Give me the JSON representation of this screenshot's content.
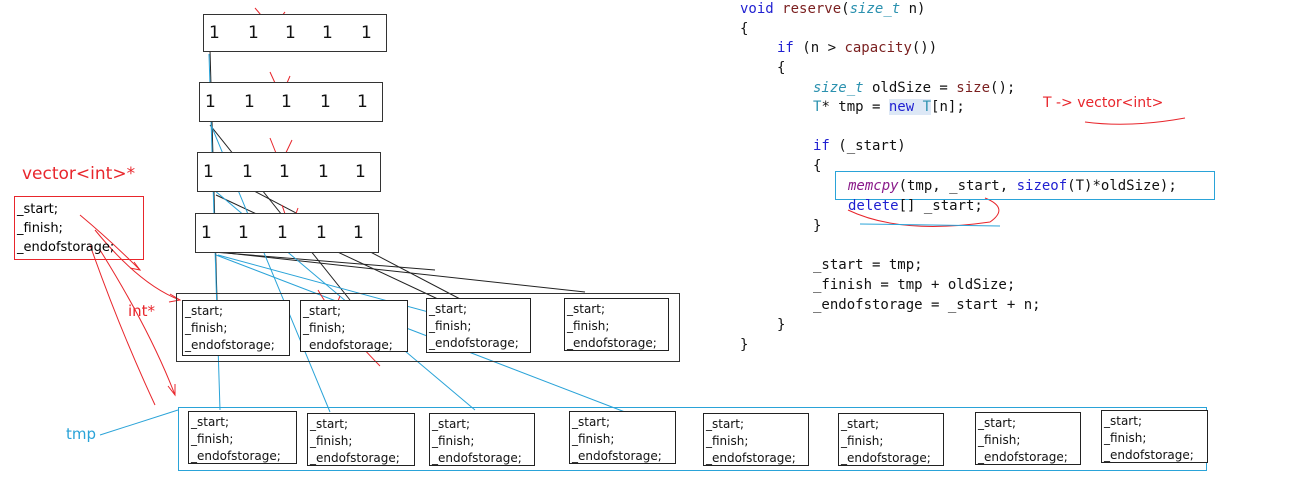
{
  "rows": [
    [
      "1",
      "1",
      "1",
      "1",
      "1"
    ],
    [
      "1",
      "1",
      "1",
      "1",
      "1"
    ],
    [
      "1",
      "1",
      "1",
      "1",
      "1"
    ],
    [
      "1",
      "1",
      "1",
      "1",
      "1"
    ]
  ],
  "vector_box": {
    "title": "vector<int>*",
    "fields": [
      "_start;",
      "_finish;",
      "_endofstorage;"
    ]
  },
  "labels": {
    "int_ptr": "int*",
    "tmp": "tmp"
  },
  "old_cells": [
    [
      "_start;",
      "_finish;",
      "_endofstorage;"
    ],
    [
      "_start;",
      "_finish;",
      "_endofstorage;"
    ],
    [
      "_start;",
      "_finish;",
      "_endofstorage;"
    ],
    [
      "_start;",
      "_finish;",
      "_endofstorage;"
    ]
  ],
  "new_cells": [
    [
      "_start;",
      "_finish;",
      "_endofstorage;"
    ],
    [
      "_start;",
      "_finish;",
      "_endofstorage;"
    ],
    [
      "_start;",
      "_finish;",
      "_endofstorage;"
    ],
    [
      "_start;",
      "_finish;",
      "_endofstorage;"
    ],
    [
      "_start;",
      "_finish;",
      "_endofstorage;"
    ],
    [
      "_start;",
      "_finish;",
      "_endofstorage;"
    ],
    [
      "_start;",
      "_finish;",
      "_endofstorage;"
    ],
    [
      "_start;",
      "_finish;",
      "_endofstorage;"
    ]
  ],
  "code": {
    "l1_kw": "void",
    "l1_fn": "reserve",
    "l1_a": "(",
    "l1_ty": "size_t",
    "l1_b": " n)",
    "l2": "{",
    "l3_kw": "if",
    "l3_a": " (n > ",
    "l3_fn": "capacity",
    "l3_b": "())",
    "l4": "{",
    "l5_ty": "size_t",
    "l5_a": " oldSize = ",
    "l5_fn": "size",
    "l5_b": "();",
    "l6_ty": "T",
    "l6_a": "* tmp = ",
    "l6_kw": "new",
    "l6_ty2": "T",
    "l6_b": "[n];",
    "l7_a": "if",
    "l7_b": " (_start)",
    "l8": "{",
    "l9_it": "memcpy",
    "l9_a": "(tmp, _start, ",
    "l9_kw": "sizeof",
    "l9_b": "(T)*oldSize);",
    "l10_kw": "delete",
    "l10_a": "[] _start;",
    "l11": "}",
    "l12": "_start = tmp;",
    "l13": "_finish = tmp + oldSize;",
    "l14": "_endofstorage = _start + n;",
    "l15": "}",
    "l16": "}"
  },
  "annotation": "T -> vector<int>",
  "colors": {
    "red": "#e8262c",
    "blue": "#2aa3d8",
    "black": "#222222"
  }
}
